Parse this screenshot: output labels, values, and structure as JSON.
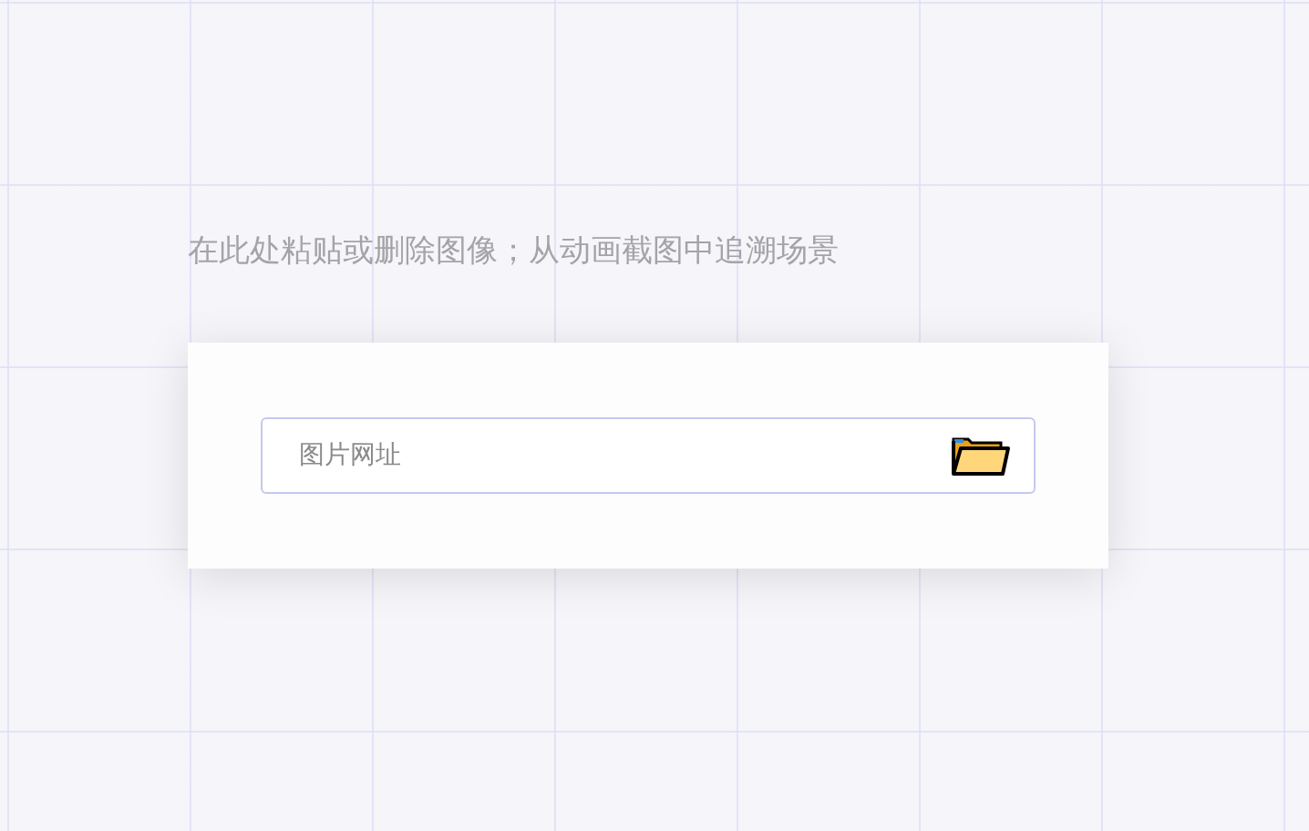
{
  "hint": "在此处粘贴或删除图像；从动画截图中追溯场景",
  "url_field": {
    "placeholder": "图片网址"
  }
}
